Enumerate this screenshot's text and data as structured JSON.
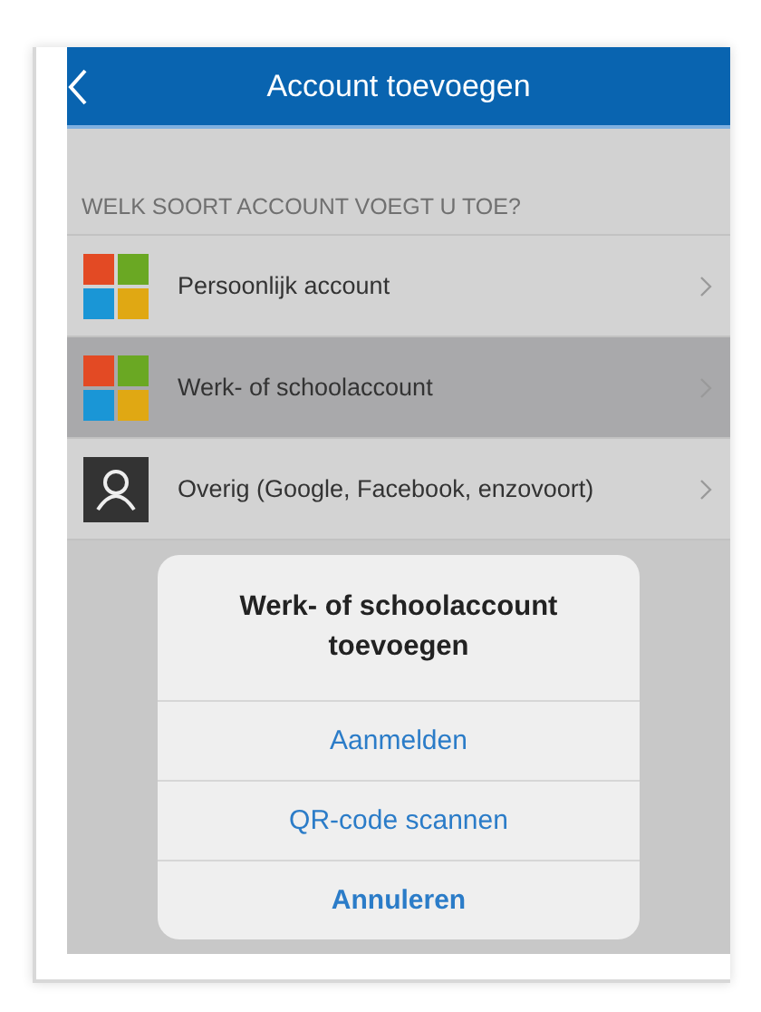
{
  "header": {
    "title": "Account toevoegen"
  },
  "section_label": "WELK SOORT ACCOUNT VOEGT U TOE?",
  "accounts": [
    {
      "label": "Persoonlijk account",
      "kind": "microsoft",
      "selected": false
    },
    {
      "label": "Werk- of schoolaccount",
      "kind": "microsoft",
      "selected": true
    },
    {
      "label": "Overig (Google, Facebook, enzovoort)",
      "kind": "person",
      "selected": false
    }
  ],
  "dialog": {
    "title": "Werk- of schoolaccount toevoegen",
    "actions": [
      {
        "label": "Aanmelden",
        "kind": "default"
      },
      {
        "label": "QR-code scannen",
        "kind": "default"
      },
      {
        "label": "Annuleren",
        "kind": "cancel"
      }
    ]
  }
}
